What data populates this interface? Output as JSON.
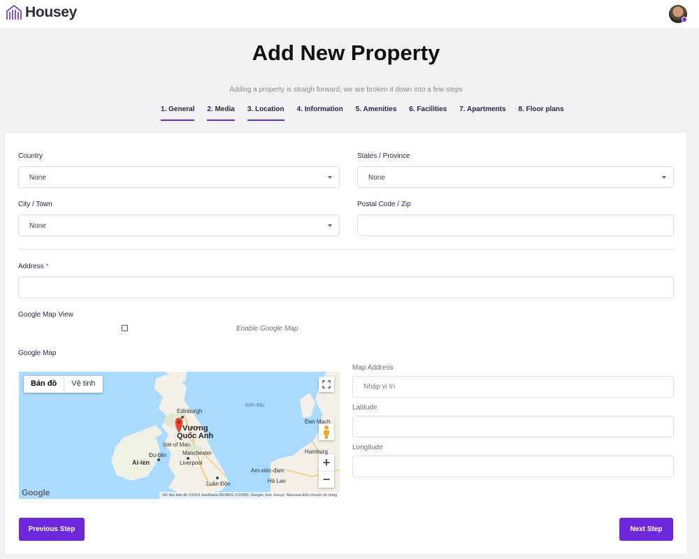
{
  "brand": {
    "name": "Housey",
    "accent": "#6d28d9"
  },
  "header": {
    "title": "Add New Property",
    "subtitle": "Adding a property is straigh forward, we are broken it down into a few steps"
  },
  "steps": [
    {
      "label": "1. General",
      "done": true
    },
    {
      "label": "2. Media",
      "done": true
    },
    {
      "label": "3. Location",
      "done": true
    },
    {
      "label": "4. Information",
      "done": false
    },
    {
      "label": "5. Amenities",
      "done": false
    },
    {
      "label": "6. Facilities",
      "done": false
    },
    {
      "label": "7. Apartments",
      "done": false
    },
    {
      "label": "8. Floor plans",
      "done": false
    }
  ],
  "form": {
    "country": {
      "label": "Country",
      "value": "None"
    },
    "state": {
      "label": "States / Province",
      "value": "None"
    },
    "city": {
      "label": "City / Town",
      "value": "None"
    },
    "postal": {
      "label": "Postal Code / Zip",
      "value": ""
    },
    "address": {
      "label": "Address",
      "required_mark": "*",
      "value": ""
    },
    "map_view": {
      "label": "Google Map View",
      "checkbox_label": "Enable Google Map",
      "checked": false
    },
    "google_map_label": "Google Map",
    "map_address": {
      "label": "Map Address",
      "placeholder": "Nhập vị trí"
    },
    "latitude": {
      "label": "Latitude",
      "value": ""
    },
    "longitude": {
      "label": "Longitude",
      "value": ""
    }
  },
  "map": {
    "type_tabs": [
      "Bản đồ",
      "Vệ tinh"
    ],
    "labels": {
      "edinburgh": "Edinburgh",
      "bien_bac": "Biển Bắc",
      "vuong": "Vương",
      "quoc_anh": "Quốc Anh",
      "isle_of_man": "Isle of Man",
      "dan_mach": "Đan Mạch",
      "dublin": "Đu-blin",
      "ailen": "Ai-len",
      "manchester": "Manchester",
      "liverpool": "Liverpool",
      "hamburg": "Hamburg",
      "amxtecdam": "Am-xtéc-đam",
      "halan": "Hà Lan",
      "luandon": "Luân Đôn"
    },
    "google": "Google",
    "footer": "Dữ liệu bản đồ ©2019 GeoBasis-DE/BKG (©2009), Google, Inst. Geogr. Nacional    Điều khoản sử dụng",
    "zoom_in": "+",
    "zoom_out": "−"
  },
  "buttons": {
    "prev": "Previous Step",
    "next": "Next Step"
  }
}
